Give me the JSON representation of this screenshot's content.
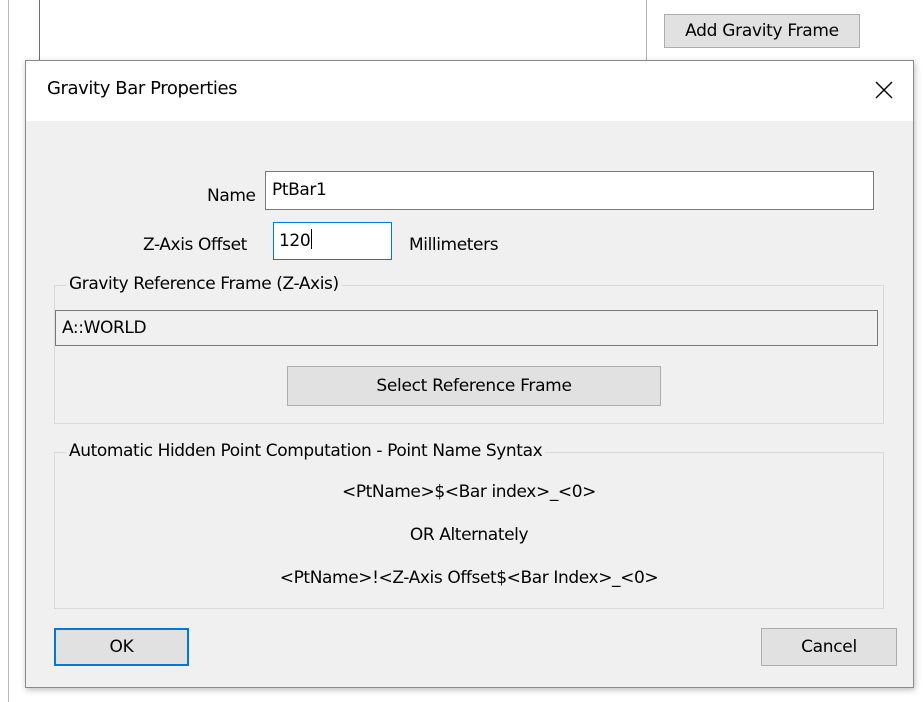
{
  "background": {
    "add_gravity_frame_label": "Add Gravity Frame"
  },
  "dialog": {
    "title": "Gravity Bar Properties",
    "close_icon": "close-icon",
    "name_label": "Name",
    "name_value": "PtBar1",
    "z_offset_label": "Z-Axis Offset",
    "z_offset_value": "120",
    "units_label": "Millimeters",
    "ref_group": {
      "legend": "Gravity Reference Frame (Z-Axis)",
      "value": "A::WORLD",
      "select_button_label": "Select Reference Frame"
    },
    "syntax_group": {
      "legend": "Automatic Hidden Point Computation - Point Name Syntax",
      "line1": "<PtName>$<Bar index>_<0>",
      "line2": "OR Alternately",
      "line3": "<PtName>!<Z-Axis Offset$<Bar Index>_<0>"
    },
    "ok_label": "OK",
    "cancel_label": "Cancel"
  },
  "colors": {
    "dialog_bg": "#f0f0f0",
    "focus_border": "#0078d7",
    "button_bg": "#e1e1e1"
  }
}
